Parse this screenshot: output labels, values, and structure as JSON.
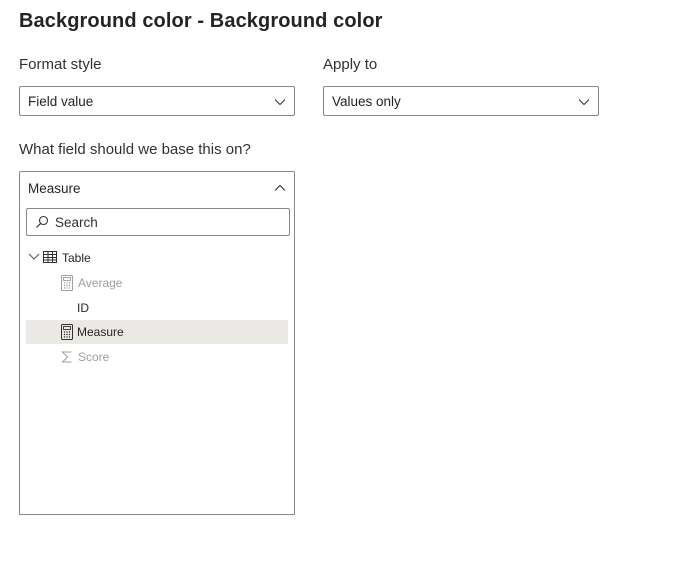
{
  "title": "Background color - Background color",
  "format_style": {
    "label": "Format style",
    "value": "Field value"
  },
  "apply_to": {
    "label": "Apply to",
    "value": "Values only"
  },
  "base_field": {
    "label": "What field should we base this on?",
    "value": "Measure",
    "search_placeholder": "Search",
    "table": {
      "name": "Table",
      "items": [
        {
          "label": "Average",
          "icon": "calculator-icon",
          "disabled": true,
          "selected": false
        },
        {
          "label": "ID",
          "icon": "none",
          "disabled": false,
          "selected": false
        },
        {
          "label": "Measure",
          "icon": "calculator-icon",
          "disabled": false,
          "selected": true
        },
        {
          "label": "Score",
          "icon": "sigma-icon",
          "disabled": true,
          "selected": false
        }
      ]
    }
  },
  "colors": {
    "border": "#8a8886",
    "selected_row": "#ebe9e6",
    "disabled_text": "#a19f9d",
    "text": "#252423"
  }
}
